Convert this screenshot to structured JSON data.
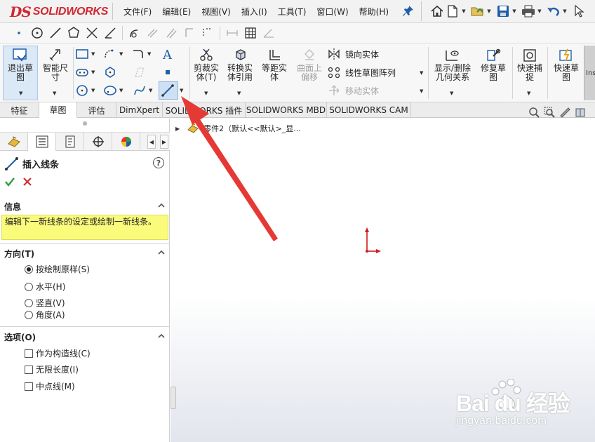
{
  "app": {
    "logo_ds": "DS",
    "logo_name": "SOLIDWORKS"
  },
  "menu": [
    "文件(F)",
    "编辑(E)",
    "视图(V)",
    "插入(I)",
    "工具(T)",
    "窗口(W)",
    "帮助(H)"
  ],
  "command_manager": {
    "exit_sketch": "退出草图",
    "smart_dimension": "智能尺寸",
    "trim_entities": "剪裁实体(T)",
    "convert_entities": "转换实体引用",
    "offset_entities": "等距实体",
    "surface_offset": "曲面上偏移",
    "mirror_entities": "镜向实体",
    "linear_pattern": "线性草图阵列",
    "move_entities": "移动实体",
    "display_relations": "显示/删除几何关系",
    "repair_sketch": "修复草图",
    "quick_snaps": "快速捕捉",
    "rapid_sketch": "快速草图",
    "cut_label": "Ins"
  },
  "tabs": [
    "特征",
    "草图",
    "评估",
    "DimXpert",
    "SOLIDWORKS 插件",
    "SOLIDWORKS MBD",
    "SOLIDWORKS CAM"
  ],
  "active_tab": "草图",
  "property_manager": {
    "title": "插入线条",
    "help": "?",
    "info": {
      "header": "信息",
      "message": "编辑下一新线条的设定或绘制一新线条。"
    },
    "orientation": {
      "header": "方向(T)",
      "options": [
        {
          "label": "按绘制原样(S)",
          "selected": true
        },
        {
          "label": "水平(H)",
          "selected": false
        },
        {
          "label": "竖直(V)",
          "selected": false
        },
        {
          "label": "角度(A)",
          "selected": false
        }
      ]
    },
    "options": {
      "header": "选项(O)",
      "items": [
        {
          "label": "作为构造线(C)",
          "checked": false
        },
        {
          "label": "无限长度(I)",
          "checked": false
        },
        {
          "label": "中点线(M)",
          "checked": false
        }
      ]
    }
  },
  "feature_tree": {
    "part_label": "零件2（默认<<默认>_显..."
  },
  "watermark": {
    "brand": "Bai du 经验",
    "site": "jingyan.baidu.com"
  },
  "colors": {
    "brand_red": "#d22630",
    "info_yellow": "#fbfb7b",
    "annotation_arrow": "#e53935",
    "icon_blue": "#1f5fa8"
  }
}
